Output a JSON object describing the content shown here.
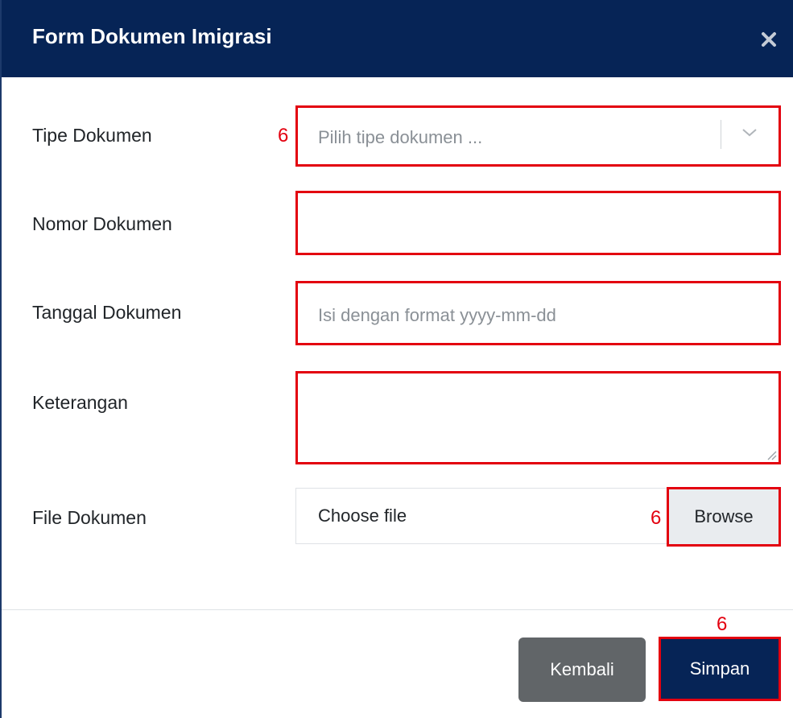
{
  "modal": {
    "title": "Form Dokumen Imigrasi",
    "close_icon": "close-icon"
  },
  "form": {
    "tipe": {
      "label": "Tipe Dokumen",
      "placeholder": "Pilih tipe dokumen ...",
      "marker": "6"
    },
    "nomor": {
      "label": "Nomor Dokumen",
      "value": ""
    },
    "tanggal": {
      "label": "Tanggal Dokumen",
      "placeholder": "Isi dengan format yyyy-mm-dd"
    },
    "keterangan": {
      "label": "Keterangan",
      "value": ""
    },
    "file": {
      "label": "File Dokumen",
      "choose_text": "Choose file",
      "browse_label": "Browse",
      "marker": "6"
    }
  },
  "footer": {
    "kembali_label": "Kembali",
    "simpan_label": "Simpan",
    "marker": "6"
  },
  "colors": {
    "header_bg": "#062456",
    "highlight": "#e3000f",
    "secondary_button": "#616568"
  }
}
